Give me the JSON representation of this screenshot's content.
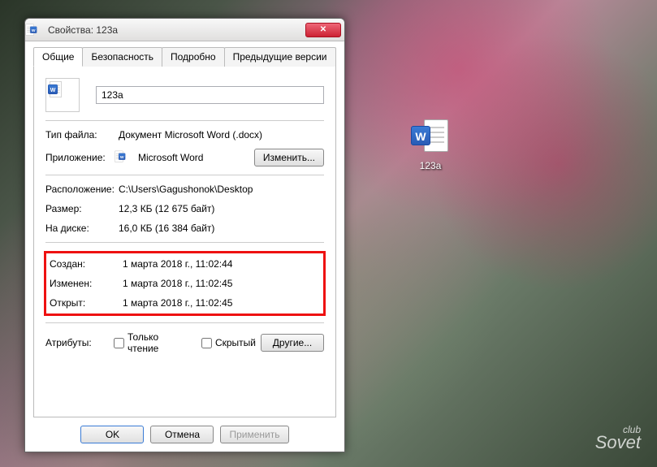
{
  "desktop": {
    "icon_label": "123a",
    "watermark_top": "club",
    "watermark_main": "Sovet"
  },
  "dialog": {
    "title": "Свойства: 123a",
    "tabs": {
      "general": "Общие",
      "security": "Безопасность",
      "details": "Подробно",
      "previous": "Предыдущие версии"
    },
    "filename": "123a",
    "rows": {
      "filetype_label": "Тип файла:",
      "filetype_value": "Документ Microsoft Word (.docx)",
      "app_label": "Приложение:",
      "app_value": "Microsoft Word",
      "change_btn": "Изменить...",
      "location_label": "Расположение:",
      "location_value": "C:\\Users\\Gagushonok\\Desktop",
      "size_label": "Размер:",
      "size_value": "12,3 КБ (12 675 байт)",
      "disk_label": "На диске:",
      "disk_value": "16,0 КБ (16 384 байт)",
      "created_label": "Создан:",
      "created_value": "1 марта 2018 г., 11:02:44",
      "modified_label": "Изменен:",
      "modified_value": "1 марта 2018 г., 11:02:45",
      "accessed_label": "Открыт:",
      "accessed_value": "1 марта 2018 г., 11:02:45",
      "attributes_label": "Атрибуты:",
      "readonly_label": "Только чтение",
      "hidden_label": "Скрытый",
      "other_btn": "Другие..."
    },
    "buttons": {
      "ok": "OK",
      "cancel": "Отмена",
      "apply": "Применить"
    }
  }
}
